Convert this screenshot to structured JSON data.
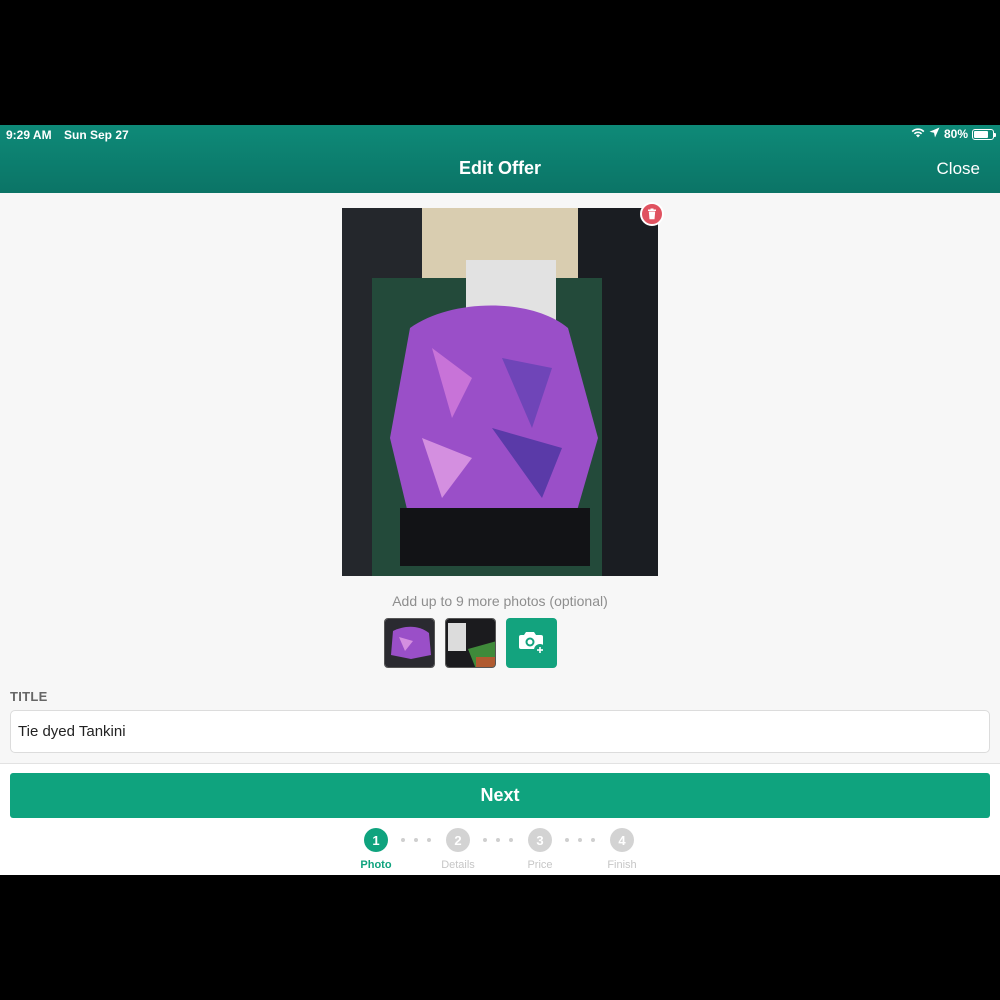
{
  "status_bar": {
    "time": "9:29 AM",
    "date": "Sun Sep 27",
    "battery": "80%",
    "battery_level": 0.8
  },
  "header": {
    "title": "Edit Offer",
    "close_label": "Close"
  },
  "photos": {
    "hint": "Add up to 9 more photos (optional)"
  },
  "form": {
    "title_label": "TITLE",
    "title_value": "Tie dyed Tankini"
  },
  "footer": {
    "next_label": "Next"
  },
  "steps": [
    {
      "number": "1",
      "label": "Photo",
      "active": true
    },
    {
      "number": "2",
      "label": "Details",
      "active": false
    },
    {
      "number": "3",
      "label": "Price",
      "active": false
    },
    {
      "number": "4",
      "label": "Finish",
      "active": false
    }
  ],
  "colors": {
    "accent": "#0fa37e",
    "header": "#0e8a78",
    "delete": "#e05260"
  },
  "icons": [
    "wifi-icon",
    "location-arrow-icon",
    "battery-icon",
    "trash-icon",
    "camera-add-icon"
  ]
}
